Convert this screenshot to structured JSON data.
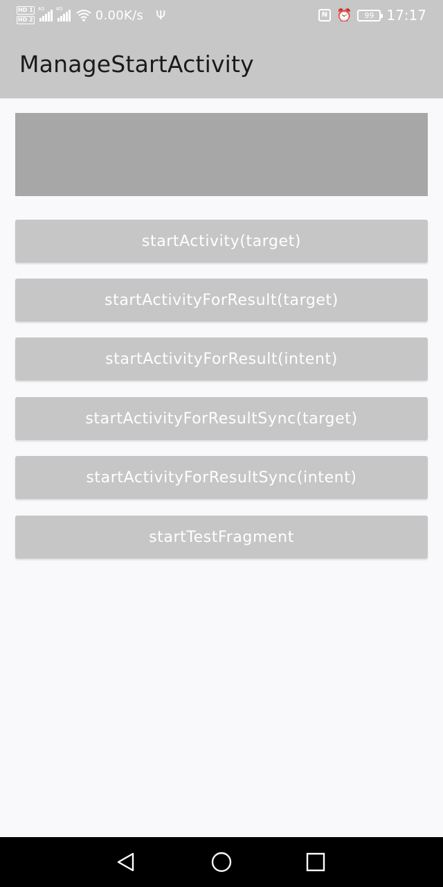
{
  "status_bar": {
    "net_badge_1": "HD 1",
    "net_badge_2": "HD 2",
    "signal_1_tag": "4G",
    "signal_2_tag": "4G",
    "speed": "0.00K/s",
    "usb_icon": "usb-icon",
    "nfc_label": "N",
    "battery_level": "99",
    "time": "17:17",
    "color": "#c7c7c7"
  },
  "app_bar": {
    "title": "ManageStartActivity",
    "color": "#c7c7c7"
  },
  "content_block": {
    "color": "#a7a7a7"
  },
  "buttons": [
    {
      "label": "startActivity(target)"
    },
    {
      "label": "startActivityForResult(target)"
    },
    {
      "label": "startActivityForResult(intent)"
    },
    {
      "label": "startActivityForResultSync(target)"
    },
    {
      "label": "startActivityForResultSync(intent)"
    },
    {
      "label": "startTestFragment"
    }
  ],
  "nav_bar": {
    "back_icon": "triangle-back-icon",
    "home_icon": "circle-home-icon",
    "recents_icon": "square-recents-icon"
  }
}
